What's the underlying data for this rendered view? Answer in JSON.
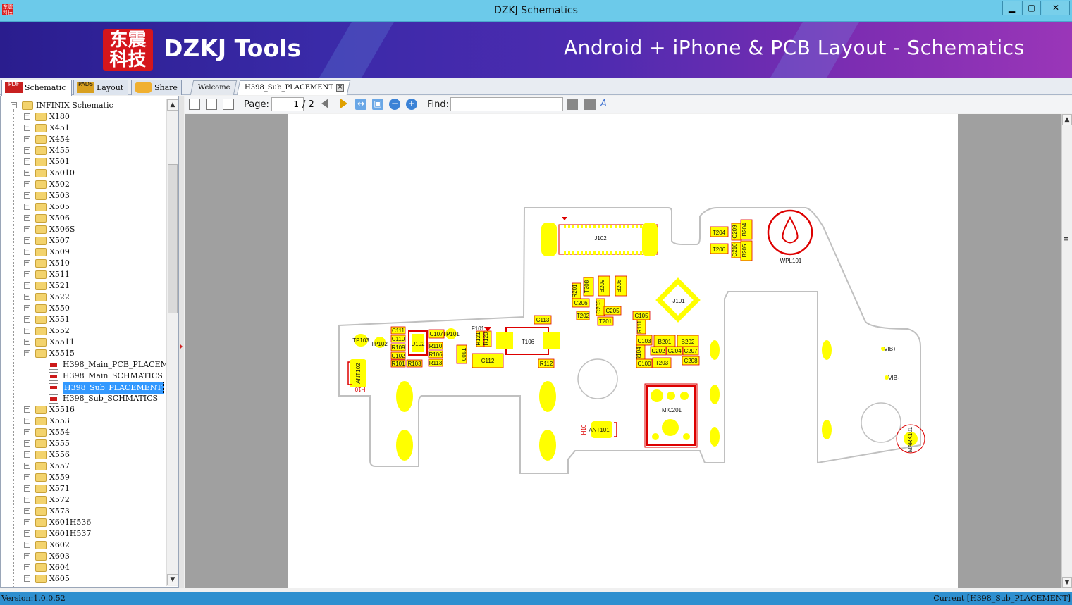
{
  "window": {
    "title": "DZKJ Schematics",
    "minimize": "▁",
    "maximize": "▢",
    "close": "✕",
    "app_icon_text": "东震科技"
  },
  "banner": {
    "logo_text": "东震科技",
    "brand": "DZKJ Tools",
    "tagline": "Android + iPhone & PCB Layout - Schematics"
  },
  "left_tabs": [
    {
      "label": "Schematic",
      "icon": "PDF"
    },
    {
      "label": "Layout",
      "icon": "PADS"
    },
    {
      "label": "Share",
      "icon": ""
    }
  ],
  "doc_tabs": [
    {
      "label": "Welcome"
    },
    {
      "label": "H398_Sub_PLACEMENT"
    }
  ],
  "tree": {
    "root": "INFINIX Schematic",
    "folders_before": [
      "X180",
      "X451",
      "X454",
      "X455",
      "X501",
      "X5010",
      "X502",
      "X503",
      "X505",
      "X506",
      "X506S",
      "X507",
      "X509",
      "X510",
      "X511",
      "X521",
      "X522",
      "X550",
      "X551",
      "X552",
      "X5511"
    ],
    "open_folder": "X5515",
    "files": [
      "H398_Main_PCB_PLACEMENT",
      "H398_Main_SCHMATICS",
      "H398_Sub_PLACEMENT",
      "H398_Sub_SCHMATICS"
    ],
    "selected_file": "H398_Sub_PLACEMENT",
    "folders_after": [
      "X5516",
      "X553",
      "X554",
      "X555",
      "X556",
      "X557",
      "X559",
      "X571",
      "X572",
      "X573",
      "X601H536",
      "X601H537",
      "X602",
      "X603",
      "X604",
      "X605"
    ]
  },
  "toolbar": {
    "page_label": "Page:",
    "page_current": "1",
    "page_total": "/ 2",
    "find_label": "Find:",
    "find_value": ""
  },
  "pcb_labels": {
    "J102": "J102",
    "WPL101": "WPL101",
    "J101": "J101",
    "T204": "T204",
    "T206": "T206",
    "C209": "C209",
    "C210": "C210",
    "B204": "B204",
    "B205": "B205",
    "R201": "R201",
    "T208": "T208",
    "B209": "B209",
    "B208": "B208",
    "C206": "C206",
    "C203": "C203",
    "C205": "C205",
    "T202": "T202",
    "T201": "T201",
    "C105": "C105",
    "R111": "R111",
    "C113": "C113",
    "F101": "F101",
    "R121": "R121",
    "R120": "R120",
    "T106": "T106",
    "C112": "C112",
    "R112": "R112",
    "TP103": "TP103",
    "TP102": "TP102",
    "C111": "C111",
    "C110": "C110",
    "R109": "R109",
    "C102": "C102",
    "R101": "R101",
    "R103": "R103",
    "U102": "U102",
    "C107": "C107",
    "TP101": "TP101",
    "R110": "R110",
    "R106": "R106",
    "R113": "R113",
    "T100": "T100",
    "C103": "C103",
    "B201": "B201",
    "B202": "B202",
    "R104": "R104",
    "C202": "C202",
    "C204": "C204",
    "C207": "C207",
    "C100": "C100",
    "T203": "T203",
    "C208": "C208",
    "ANT102": "ANT102",
    "H10": "H10",
    "MIC201": "MIC201",
    "ANT101": "ANT101",
    "VIBP": "VIB+",
    "VIBM": "VIB-",
    "MARK101": "MARK101"
  },
  "status": {
    "version": "Version:1.0.0.52",
    "current": "Current [H398_Sub_PLACEMENT]"
  },
  "colors": {
    "pad": "#ffff00",
    "outline": "#dd0000",
    "board": "#c0c0c0",
    "titlebar": "#6ccaea",
    "statusbar": "#2e8fcf"
  }
}
